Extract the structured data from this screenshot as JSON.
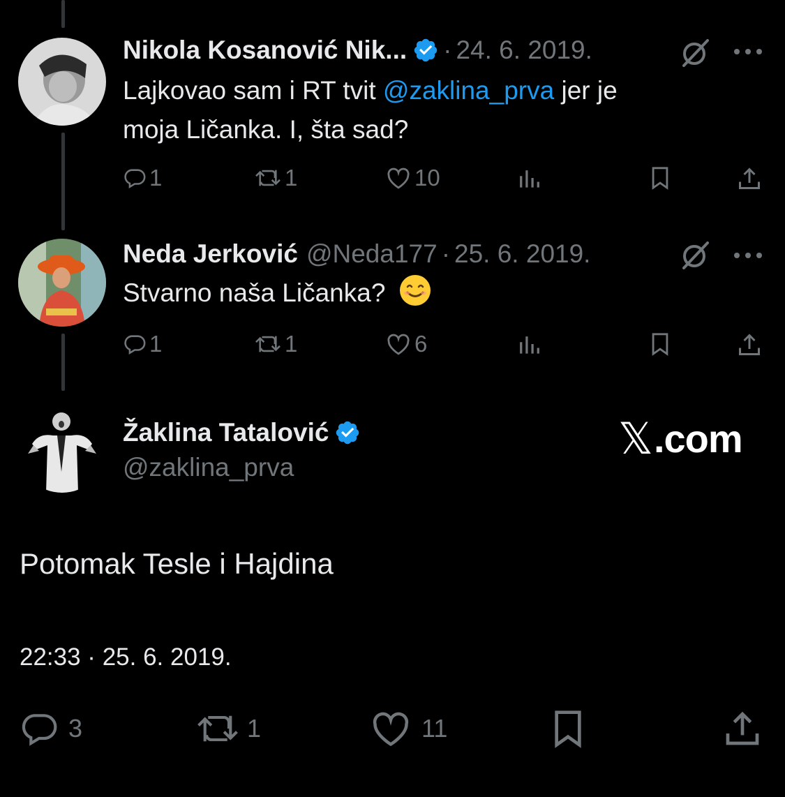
{
  "replies": [
    {
      "name": "Nikola Kosanović Nik...",
      "verified": true,
      "handle": "",
      "date": "24. 6. 2019.",
      "text_line1_pre": "Lajkovao sam i RT tvit ",
      "text_line1_mention": "@zaklina_prva",
      "text_line1_post": " jer je",
      "text_line2": "moja Ličanka. I, šta sad?",
      "replies_count": "1",
      "retweets_count": "1",
      "likes_count": "10"
    },
    {
      "name": "Neda Jerković",
      "verified": false,
      "handle": "@Neda177",
      "date": "25. 6. 2019.",
      "text": "Stvarno naša Ličanka?",
      "emoji": "smiling-face-emoji",
      "replies_count": "1",
      "retweets_count": "1",
      "likes_count": "6"
    }
  ],
  "main_tweet": {
    "name": "Žaklina Tatalović",
    "verified": true,
    "handle": "@zaklina_prva",
    "text": "Potomak Tesle i Hajdina",
    "timestamp": "22:33 · 25. 6. 2019.",
    "replies_count": "3",
    "retweets_count": "1",
    "likes_count": "11"
  },
  "brand": {
    "mark": "𝕏",
    "suffix": ".com"
  },
  "separator": "·",
  "colors": {
    "background": "#000000",
    "text": "#e7e9ea",
    "muted": "#71767b",
    "accent": "#1d9bf0",
    "thread_line": "#333639"
  }
}
